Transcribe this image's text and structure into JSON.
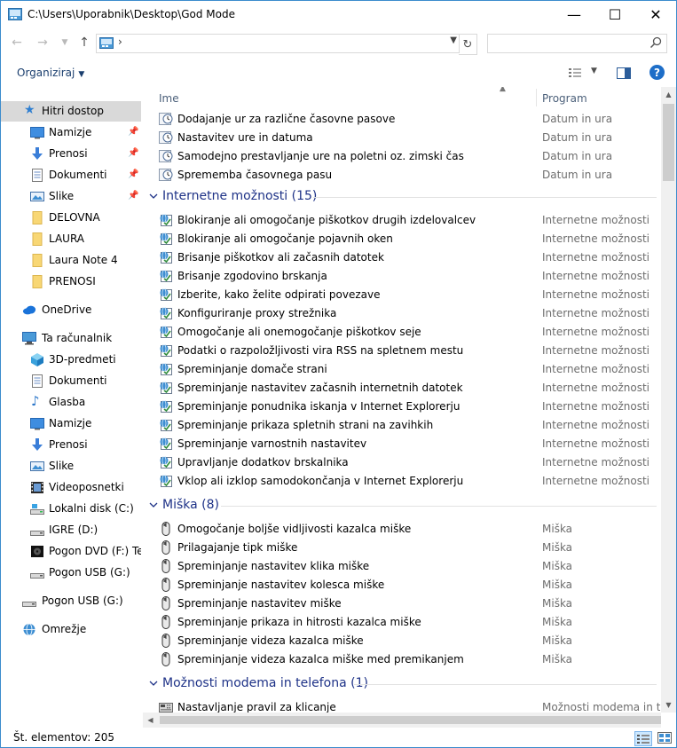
{
  "window": {
    "title": "C:\\Users\\Uporabnik\\Desktop\\God Mode",
    "buttons": {
      "minimize": "—",
      "maximize": "☐",
      "close": "✕"
    }
  },
  "address": {
    "separator": "›",
    "search_placeholder": ""
  },
  "toolbar": {
    "organize_label": "Organiziraj"
  },
  "columns": {
    "name": "Ime",
    "program": "Program"
  },
  "colors": {
    "accent": "#1e6ec8",
    "group_header": "#1e3287",
    "selection": "#d9d9d9",
    "folder": "#f8d775"
  },
  "nav": [
    {
      "label": "Hitri dostop",
      "icon": "star-icon",
      "selected": true
    },
    {
      "label": "Namizje",
      "icon": "desktop-icon",
      "pinned": true
    },
    {
      "label": "Prenosi",
      "icon": "download-icon",
      "pinned": true
    },
    {
      "label": "Dokumenti",
      "icon": "document-icon",
      "pinned": true
    },
    {
      "label": "Slike",
      "icon": "pictures-icon",
      "pinned": true
    },
    {
      "label": "DELOVNA",
      "icon": "folder-icon"
    },
    {
      "label": "LAURA",
      "icon": "folder-icon"
    },
    {
      "label": "Laura Note 4",
      "icon": "folder-icon"
    },
    {
      "label": "PRENOSI",
      "icon": "folder-icon"
    },
    {
      "label": "OneDrive",
      "icon": "cloud-icon"
    },
    {
      "label": "Ta računalnik",
      "icon": "computer-icon"
    },
    {
      "label": "3D-predmeti",
      "icon": "cube-icon"
    },
    {
      "label": "Dokumenti",
      "icon": "document-icon"
    },
    {
      "label": "Glasba",
      "icon": "music-icon"
    },
    {
      "label": "Namizje",
      "icon": "desktop-icon"
    },
    {
      "label": "Prenosi",
      "icon": "download-icon"
    },
    {
      "label": "Slike",
      "icon": "pictures-icon"
    },
    {
      "label": "Videoposnetki",
      "icon": "video-icon"
    },
    {
      "label": "Lokalni disk (C:)",
      "icon": "drive-icon"
    },
    {
      "label": "IGRE (D:)",
      "icon": "drive-icon"
    },
    {
      "label": "Pogon DVD (F:) Ten",
      "icon": "dvd-icon"
    },
    {
      "label": "Pogon USB (G:)",
      "icon": "usb-drive-icon"
    },
    {
      "label": "Pogon USB (G:)",
      "icon": "usb-drive-icon"
    },
    {
      "label": "Omrežje",
      "icon": "network-icon"
    }
  ],
  "top_items": [
    {
      "name": "Dodajanje ur za različne časovne pasove",
      "program": "Datum in ura",
      "icon": "clock-icon"
    },
    {
      "name": "Nastavitev ure in datuma",
      "program": "Datum in ura",
      "icon": "clock-icon"
    },
    {
      "name": "Samodejno prestavljanje ure na poletni oz. zimski čas",
      "program": "Datum in ura",
      "icon": "clock-icon"
    },
    {
      "name": "Sprememba časovnega pasu",
      "program": "Datum in ura",
      "icon": "clock-icon"
    }
  ],
  "groups": [
    {
      "title": "Internetne možnosti (15)",
      "items": [
        {
          "name": "Blokiranje ali omogočanje piškotkov drugih izdelovalcev",
          "program": "Internetne možnosti",
          "icon": "internet-options-icon"
        },
        {
          "name": "Blokiranje ali omogočanje pojavnih oken",
          "program": "Internetne možnosti",
          "icon": "internet-options-icon"
        },
        {
          "name": "Brisanje piškotkov ali začasnih datotek",
          "program": "Internetne možnosti",
          "icon": "internet-options-icon"
        },
        {
          "name": "Brisanje zgodovino brskanja",
          "program": "Internetne možnosti",
          "icon": "internet-options-icon"
        },
        {
          "name": "Izberite, kako želite odpirati povezave",
          "program": "Internetne možnosti",
          "icon": "internet-options-icon"
        },
        {
          "name": "Konfiguriranje proxy strežnika",
          "program": "Internetne možnosti",
          "icon": "internet-options-icon"
        },
        {
          "name": "Omogočanje ali onemogočanje piškotkov seje",
          "program": "Internetne možnosti",
          "icon": "internet-options-icon"
        },
        {
          "name": "Podatki o razpoložljivosti vira RSS na spletnem mestu",
          "program": "Internetne možnosti",
          "icon": "internet-options-icon"
        },
        {
          "name": "Spreminjanje domače strani",
          "program": "Internetne možnosti",
          "icon": "internet-options-icon"
        },
        {
          "name": "Spreminjanje nastavitev začasnih internetnih datotek",
          "program": "Internetne možnosti",
          "icon": "internet-options-icon"
        },
        {
          "name": "Spreminjanje ponudnika iskanja v Internet Explorerju",
          "program": "Internetne možnosti",
          "icon": "internet-options-icon"
        },
        {
          "name": "Spreminjanje prikaza spletnih strani na zavihkih",
          "program": "Internetne možnosti",
          "icon": "internet-options-icon"
        },
        {
          "name": "Spreminjanje varnostnih nastavitev",
          "program": "Internetne možnosti",
          "icon": "internet-options-icon"
        },
        {
          "name": "Upravljanje dodatkov brskalnika",
          "program": "Internetne možnosti",
          "icon": "internet-options-icon"
        },
        {
          "name": "Vklop ali izklop samodokončanja v Internet Explorerju",
          "program": "Internetne možnosti",
          "icon": "internet-options-icon"
        }
      ]
    },
    {
      "title": "Miška (8)",
      "items": [
        {
          "name": "Omogočanje boljše vidljivosti kazalca miške",
          "program": "Miška",
          "icon": "mouse-icon"
        },
        {
          "name": "Prilagajanje tipk miške",
          "program": "Miška",
          "icon": "mouse-icon"
        },
        {
          "name": "Spreminjanje nastavitev klika miške",
          "program": "Miška",
          "icon": "mouse-icon"
        },
        {
          "name": "Spreminjanje nastavitev kolesca miške",
          "program": "Miška",
          "icon": "mouse-icon"
        },
        {
          "name": "Spreminjanje nastavitev miške",
          "program": "Miška",
          "icon": "mouse-icon"
        },
        {
          "name": "Spreminjanje prikaza in hitrosti kazalca miške",
          "program": "Miška",
          "icon": "mouse-icon"
        },
        {
          "name": "Spreminjanje videza kazalca miške",
          "program": "Miška",
          "icon": "mouse-icon"
        },
        {
          "name": "Spreminjanje videza kazalca miške med premikanjem",
          "program": "Miška",
          "icon": "mouse-icon"
        }
      ]
    },
    {
      "title": "Možnosti modema in telefona (1)",
      "items": [
        {
          "name": "Nastavljanje pravil za klicanje",
          "program": "Možnosti modema in telefona",
          "icon": "phone-modem-icon"
        }
      ]
    }
  ],
  "status": {
    "count": "Št. elementov: 205"
  }
}
